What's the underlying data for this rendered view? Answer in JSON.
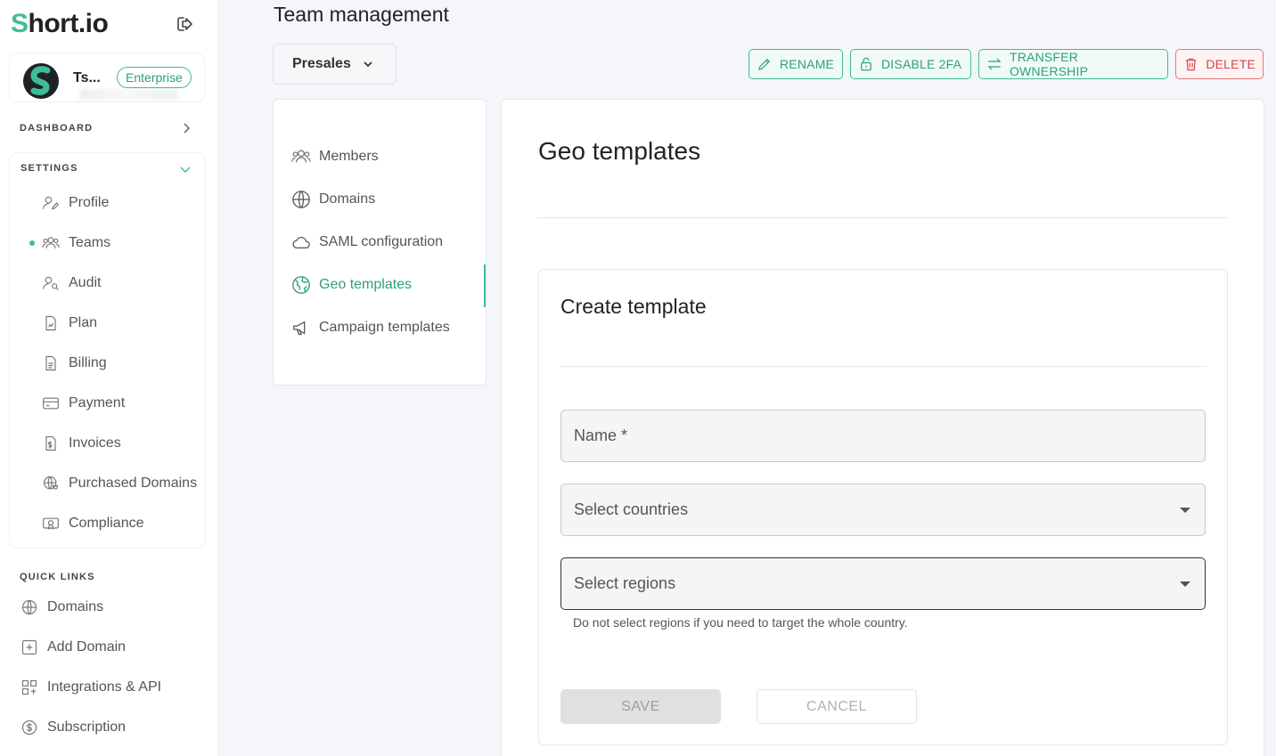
{
  "app": {
    "logo_first": "S",
    "logo_rest": "hort.io"
  },
  "account": {
    "name": "Ts...",
    "plan_badge": "Enterprise"
  },
  "sidebar": {
    "dashboard_label": "DASHBOARD",
    "settings_label": "SETTINGS",
    "settings_items": [
      {
        "label": "Profile",
        "icon": "user-edit-icon"
      },
      {
        "label": "Teams",
        "icon": "users-icon",
        "active": true
      },
      {
        "label": "Audit",
        "icon": "user-search-icon"
      },
      {
        "label": "Plan",
        "icon": "document-chart-icon"
      },
      {
        "label": "Billing",
        "icon": "document-icon"
      },
      {
        "label": "Payment",
        "icon": "credit-card-icon"
      },
      {
        "label": "Invoices",
        "icon": "invoice-icon"
      },
      {
        "label": "Purchased Domains",
        "icon": "globe-cart-icon"
      },
      {
        "label": "Compliance",
        "icon": "certificate-icon"
      }
    ],
    "quick_links_label": "QUICK LINKS",
    "quick_links": [
      {
        "label": "Domains",
        "icon": "www-globe-icon"
      },
      {
        "label": "Add Domain",
        "icon": "plus-square-icon"
      },
      {
        "label": "Integrations & API",
        "icon": "integrations-icon"
      },
      {
        "label": "Subscription",
        "icon": "dollar-circle-icon"
      }
    ]
  },
  "header": {
    "title": "Team management",
    "team_select_value": "Presales",
    "actions": {
      "rename": "RENAME",
      "disable_2fa": "DISABLE 2FA",
      "transfer": "TRANSFER OWNERSHIP",
      "delete": "DELETE"
    }
  },
  "subnav": {
    "items": [
      {
        "label": "Members",
        "icon": "users-icon"
      },
      {
        "label": "Domains",
        "icon": "globe-icon"
      },
      {
        "label": "SAML configuration",
        "icon": "cloud-icon"
      },
      {
        "label": "Geo templates",
        "icon": "earth-icon",
        "active": true
      },
      {
        "label": "Campaign templates",
        "icon": "megaphone-icon"
      }
    ]
  },
  "content": {
    "title": "Geo templates",
    "form": {
      "title": "Create template",
      "name_placeholder": "Name *",
      "countries_placeholder": "Select countries",
      "regions_placeholder": "Select regions",
      "regions_helper": "Do not select regions if you need to target the whole country.",
      "save_label": "SAVE",
      "cancel_label": "CANCEL"
    }
  },
  "colors": {
    "accent": "#3fbd94",
    "danger": "#d64545"
  }
}
